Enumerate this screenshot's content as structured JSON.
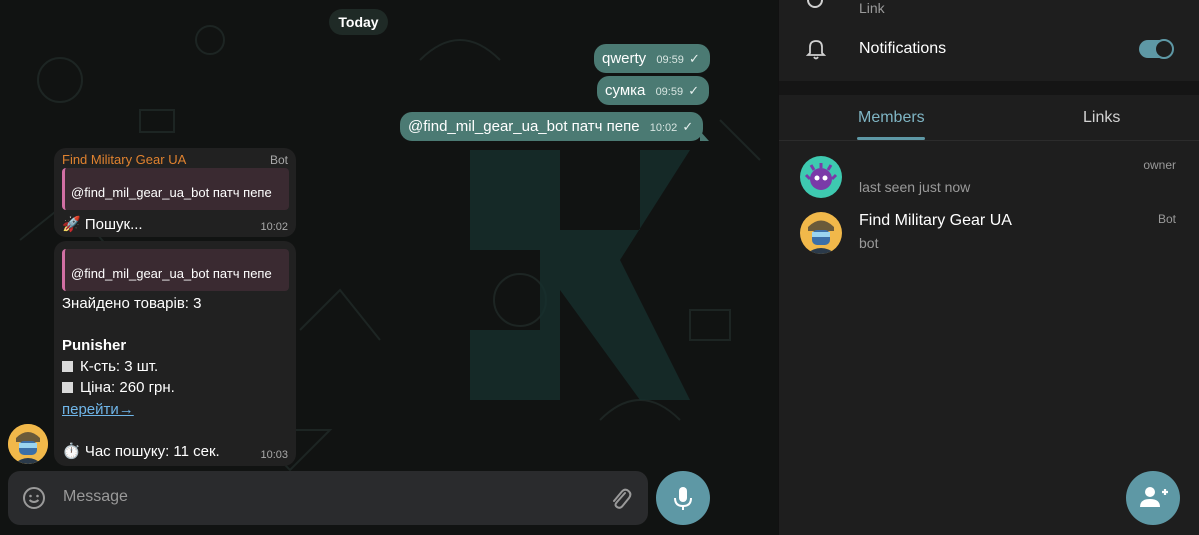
{
  "chat": {
    "date_label": "Today",
    "outgoing": [
      {
        "text": "qwerty",
        "time": "09:59"
      },
      {
        "text": "сумка",
        "time": "09:59"
      },
      {
        "text": "@find_mil_gear_ua_bot патч пепе",
        "time": "10:02"
      }
    ],
    "msg1": {
      "sender": "Find Military Gear UA",
      "badge": "Bot",
      "reply": "@find_mil_gear_ua_bot патч пепе",
      "text": "🚀 Пошук...",
      "time": "10:02"
    },
    "msg2": {
      "reply": "@find_mil_gear_ua_bot патч пепе",
      "found": "Знайдено товарів: 3",
      "product": "Punisher",
      "qty": "К-сть: 3 шт.",
      "price": "Ціна: 260 грн.",
      "link": "перейти→",
      "search_time": "⏱️ Час пошуку: 11 сек.",
      "time": "10:03"
    },
    "composer_placeholder": "Message"
  },
  "panel": {
    "link_label": "Link",
    "notifications_label": "Notifications",
    "notifications_on": true,
    "tabs": [
      "Members",
      "Links"
    ],
    "members": [
      {
        "name": "",
        "status": "last seen just now",
        "role": "owner"
      },
      {
        "name": "Find Military Gear UA",
        "status": "bot",
        "role": "Bot"
      }
    ]
  },
  "colors": {
    "accent": "#5e98a5",
    "outgoing_bubble": "#4b7a73",
    "incoming_bubble": "#212121",
    "sender_name": "#e0822f",
    "reply_border": "#d16fa3"
  }
}
